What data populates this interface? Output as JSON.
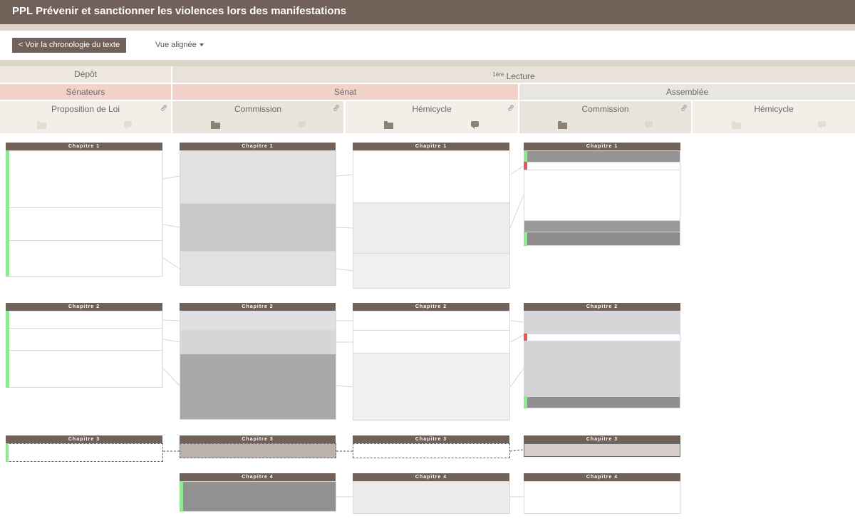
{
  "header": {
    "title": "PPL Prévenir et sanctionner les violences lors des manifestations"
  },
  "toolbar": {
    "back_label": "< Voir la chronologie du texte",
    "view_label": "Vue alignée"
  },
  "stages": {
    "depot": "Dépôt",
    "lecture_sup": "1ère",
    "lecture": "Lecture"
  },
  "chambers": {
    "senateurs": "Sénateurs",
    "senat": "Sénat",
    "assemblee": "Assemblée"
  },
  "steps": {
    "proposition": "Proposition de Loi",
    "senat_commission": "Commission",
    "senat_hemicycle": "Hémicycle",
    "an_commission": "Commission",
    "an_hemicycle": "Hémicycle"
  },
  "colors": {
    "brand": "#716259",
    "band": "#ddd5ca",
    "stage_bg": "#efe9e1",
    "senat_bg": "#f2d3cb",
    "assemblee_bg": "#e8e6e3",
    "step_bg": "#f3efe8",
    "added": "#90e890",
    "removed": "#e85a5a"
  },
  "chapters": {
    "c1": "Chapitre 1",
    "c2": "Chapitre 2",
    "c3": "Chapitre 3",
    "c4": "Chapitre 4"
  }
}
